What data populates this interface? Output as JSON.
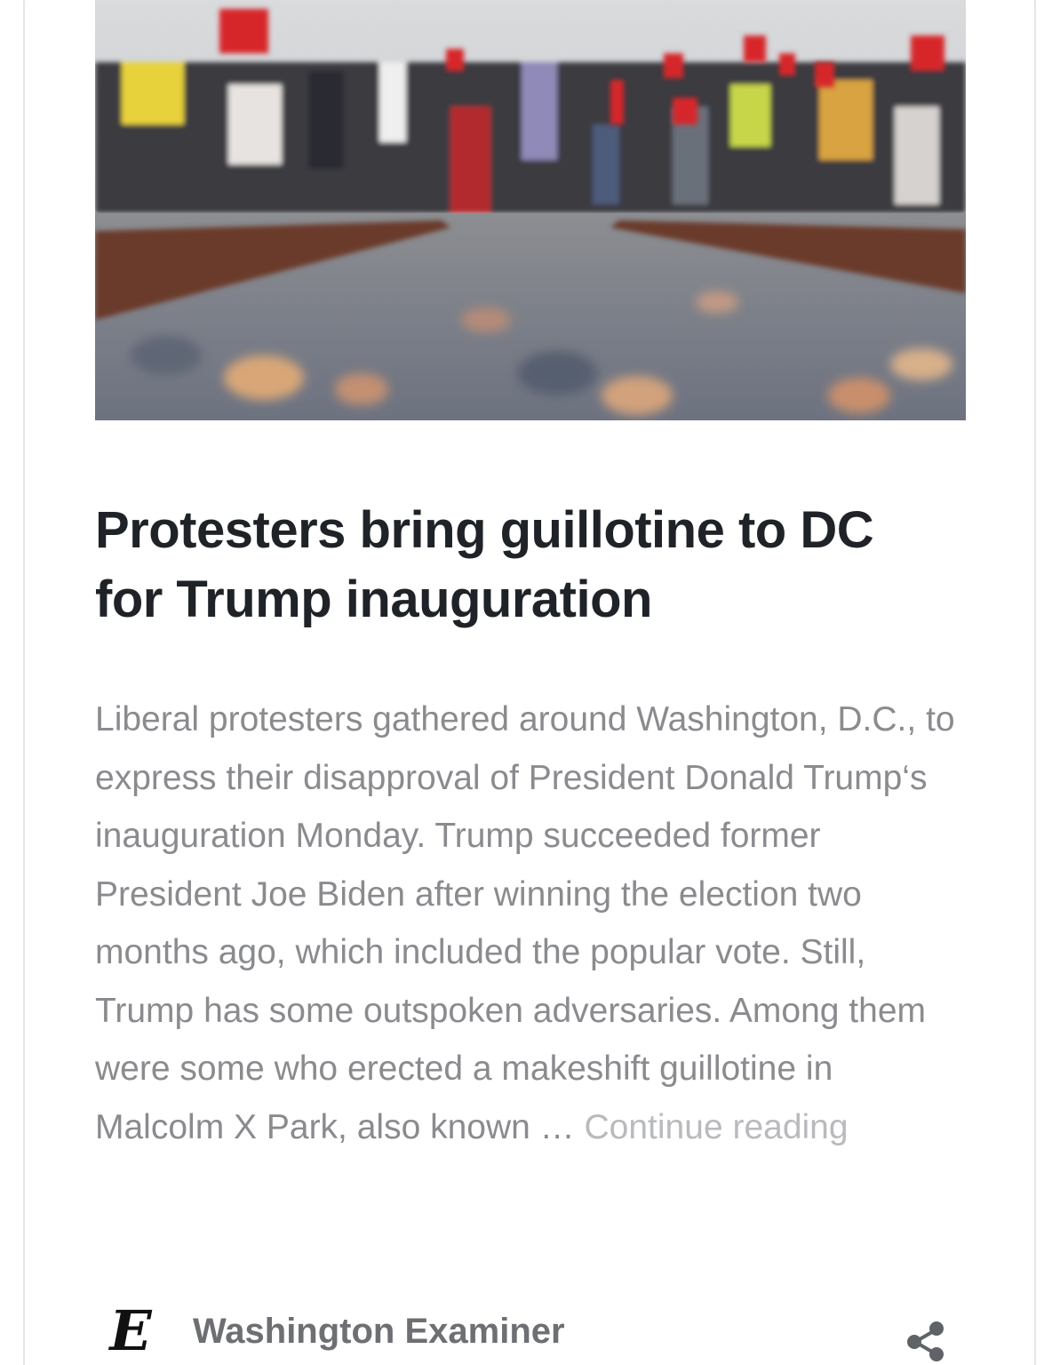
{
  "article": {
    "image_alt": "Protesters with flags and signs walking beside railroad tracks",
    "headline": "Protesters bring guillotine to DC for Trump inauguration",
    "summary": "Liberal protesters gathered around Washington, D.C., to express their disapproval of President Donald Trump‘s inauguration Monday. Trump succeeded former President Joe Biden after winning the election two months ago, which included the popular vote. Still, Trump has some outspoken adversaries. Among them were some who erected a makeshift guillotine in Malcolm X Park, also known … ",
    "continue_label": "Continue reading"
  },
  "source": {
    "logo_letter": "E",
    "name": "Washington Examiner",
    "logo_icon": "washington-examiner-logo"
  },
  "actions": {
    "share_icon": "share-icon"
  },
  "colors": {
    "headline": "#1f2328",
    "summary": "#8a8b8e",
    "continue": "#b9babd",
    "source_name": "#6d6f73",
    "card_border": "#e6e6e6"
  }
}
